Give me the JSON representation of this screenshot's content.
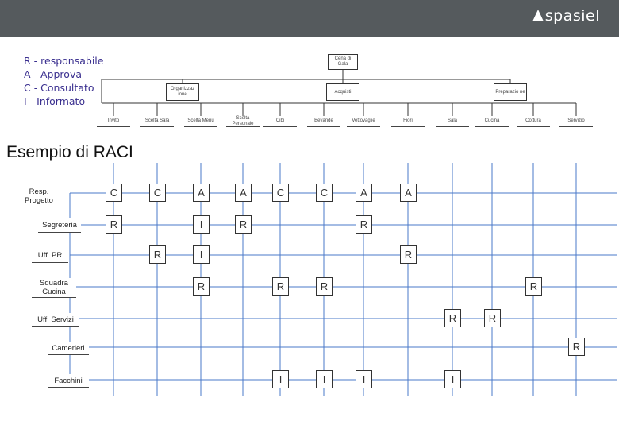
{
  "brand": {
    "logo_text": "spasiel"
  },
  "legend": [
    "R - responsabile",
    "A - Approva",
    "C - Consultato",
    "I - Informato"
  ],
  "section_title": "Esempio di RACI",
  "org": {
    "root": "Cena di Gala",
    "level2": [
      {
        "id": "org",
        "label": "Organizzaz ione"
      },
      {
        "id": "acq",
        "label": "Acquisti"
      },
      {
        "id": "prep",
        "label": "Preparazio ne"
      }
    ],
    "tasks": [
      {
        "id": "t1",
        "label": "Invito",
        "group": "org"
      },
      {
        "id": "t2",
        "label": "Scelta Sala",
        "group": "org"
      },
      {
        "id": "t3",
        "label": "Scelta Menù",
        "group": "org"
      },
      {
        "id": "t4",
        "label": "Scelta Personale",
        "group": "org"
      },
      {
        "id": "t5",
        "label": "Cibi",
        "group": "acq"
      },
      {
        "id": "t6",
        "label": "Bevande",
        "group": "acq"
      },
      {
        "id": "t7",
        "label": "Vettovaglie",
        "group": "acq"
      },
      {
        "id": "t8",
        "label": "Fiori",
        "group": "acq"
      },
      {
        "id": "t9",
        "label": "Sala",
        "group": "prep"
      },
      {
        "id": "t10",
        "label": "Cucina",
        "group": "prep"
      },
      {
        "id": "t11",
        "label": "Cottura",
        "group": "prep"
      },
      {
        "id": "t12",
        "label": "Servizio",
        "group": "prep"
      }
    ]
  },
  "roles": [
    "Resp. Progetto",
    "Segreteria",
    "Uff. PR",
    "Squadra Cucina",
    "Uff. Servizi",
    "Camerieri",
    "Facchini"
  ],
  "assignments": [
    {
      "role": 0,
      "task": 0,
      "value": "C"
    },
    {
      "role": 0,
      "task": 1,
      "value": "C"
    },
    {
      "role": 0,
      "task": 2,
      "value": "A"
    },
    {
      "role": 0,
      "task": 3,
      "value": "A"
    },
    {
      "role": 0,
      "task": 4,
      "value": "C"
    },
    {
      "role": 0,
      "task": 5,
      "value": "C"
    },
    {
      "role": 0,
      "task": 6,
      "value": "A"
    },
    {
      "role": 0,
      "task": 7,
      "value": "A"
    },
    {
      "role": 1,
      "task": 0,
      "value": "R"
    },
    {
      "role": 1,
      "task": 2,
      "value": "I"
    },
    {
      "role": 1,
      "task": 3,
      "value": "R"
    },
    {
      "role": 1,
      "task": 6,
      "value": "R"
    },
    {
      "role": 2,
      "task": 1,
      "value": "R"
    },
    {
      "role": 2,
      "task": 2,
      "value": "I"
    },
    {
      "role": 2,
      "task": 7,
      "value": "R"
    },
    {
      "role": 3,
      "task": 2,
      "value": "R"
    },
    {
      "role": 3,
      "task": 4,
      "value": "R"
    },
    {
      "role": 3,
      "task": 5,
      "value": "R"
    },
    {
      "role": 3,
      "task": 10,
      "value": "R"
    },
    {
      "role": 4,
      "task": 8,
      "value": "R"
    },
    {
      "role": 4,
      "task": 9,
      "value": "R"
    },
    {
      "role": 5,
      "task": 11,
      "value": "R"
    },
    {
      "role": 6,
      "task": 4,
      "value": "I"
    },
    {
      "role": 6,
      "task": 5,
      "value": "I"
    },
    {
      "role": 6,
      "task": 6,
      "value": "I"
    },
    {
      "role": 6,
      "task": 8,
      "value": "I"
    }
  ],
  "colors": {
    "grid": "#4a78c8",
    "legend_text": "#3a2f8f",
    "header_bar": "#555a5d"
  }
}
